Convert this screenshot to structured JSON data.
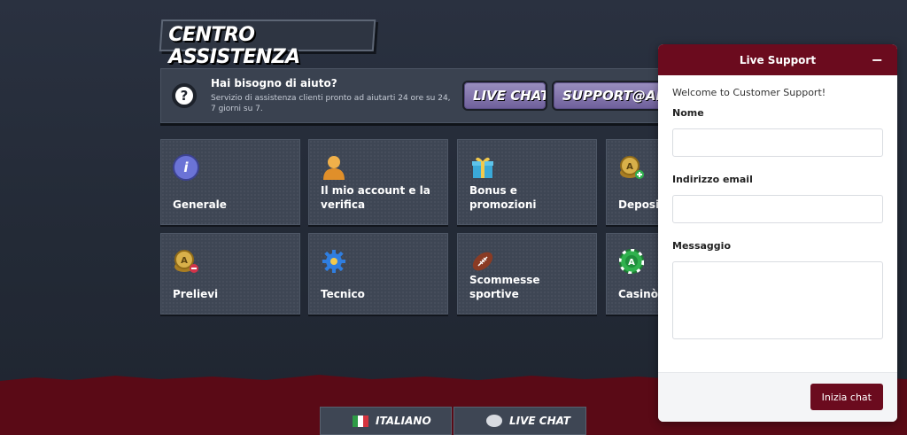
{
  "page": {
    "title": "CENTRO ASSISTENZA"
  },
  "help": {
    "heading": "Hai bisogno di aiuto?",
    "subtitle": "Servizio di assistenza clienti pronto ad aiutarti 24 ore su 24, 7 giorni su 7.",
    "live_chat_label": "LIVE CHAT",
    "email_label": "SUPPORT@ALLY"
  },
  "categories": [
    {
      "label": "Generale",
      "icon": "info-icon",
      "color": "#6b73d6"
    },
    {
      "label": "Il mio account e la verifica",
      "icon": "user-icon",
      "color": "#e8a33b"
    },
    {
      "label": "Bonus e promozioni",
      "icon": "gift-icon",
      "color": "#3aa9d8"
    },
    {
      "label": "Depositi",
      "icon": "coins-plus-icon",
      "color": "#c9a23a"
    },
    {
      "label": "Prelievi",
      "icon": "coins-minus-icon",
      "color": "#c9a23a"
    },
    {
      "label": "Tecnico",
      "icon": "gear-icon",
      "color": "#2f7ee0"
    },
    {
      "label": "Scommesse sportive",
      "icon": "football-icon",
      "color": "#8a3b24"
    },
    {
      "label": "Casinò",
      "icon": "chip-icon",
      "color": "#2fb14d"
    }
  ],
  "footer": {
    "language_label": "ITALIANO",
    "live_chat_label": "LIVE CHAT"
  },
  "widget": {
    "title": "Live Support",
    "minimize_symbol": "−",
    "welcome": "Welcome to Customer Support!",
    "name_label": "Nome",
    "email_label": "Indirizzo email",
    "message_label": "Messaggio",
    "submit_label": "Inizia chat"
  },
  "colors": {
    "brand": "#6b0b1e",
    "accent_pill": "#7e70a8"
  }
}
